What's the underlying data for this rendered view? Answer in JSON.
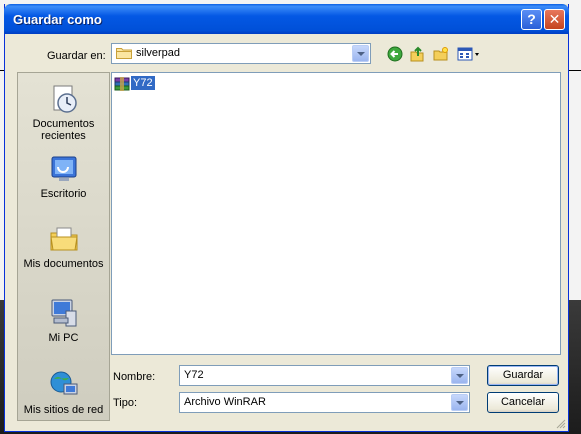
{
  "window": {
    "title": "Guardar como"
  },
  "titlebar_buttons": {
    "help": "?",
    "close": "✕"
  },
  "lookin": {
    "label": "Guardar en:",
    "value": "silverpad"
  },
  "toolbar": {
    "icons": [
      "back-icon",
      "up-folder-icon",
      "new-folder-icon",
      "view-menu-icon"
    ]
  },
  "places": [
    {
      "label": "Documentos recientes",
      "icon": "recent-documents-icon"
    },
    {
      "label": "Escritorio",
      "icon": "desktop-icon"
    },
    {
      "label": "Mis documentos",
      "icon": "my-documents-icon"
    },
    {
      "label": "Mi PC",
      "icon": "my-computer-icon"
    },
    {
      "label": "Mis sitios de red",
      "icon": "network-places-icon"
    }
  ],
  "files": [
    {
      "name": "Y72",
      "icon": "winrar-archive-icon",
      "selected": true
    }
  ],
  "filename": {
    "label": "Nombre:",
    "value": "Y72"
  },
  "filetype": {
    "label": "Tipo:",
    "value": "Archivo WinRAR"
  },
  "buttons": {
    "save": "Guardar",
    "cancel": "Cancelar"
  }
}
